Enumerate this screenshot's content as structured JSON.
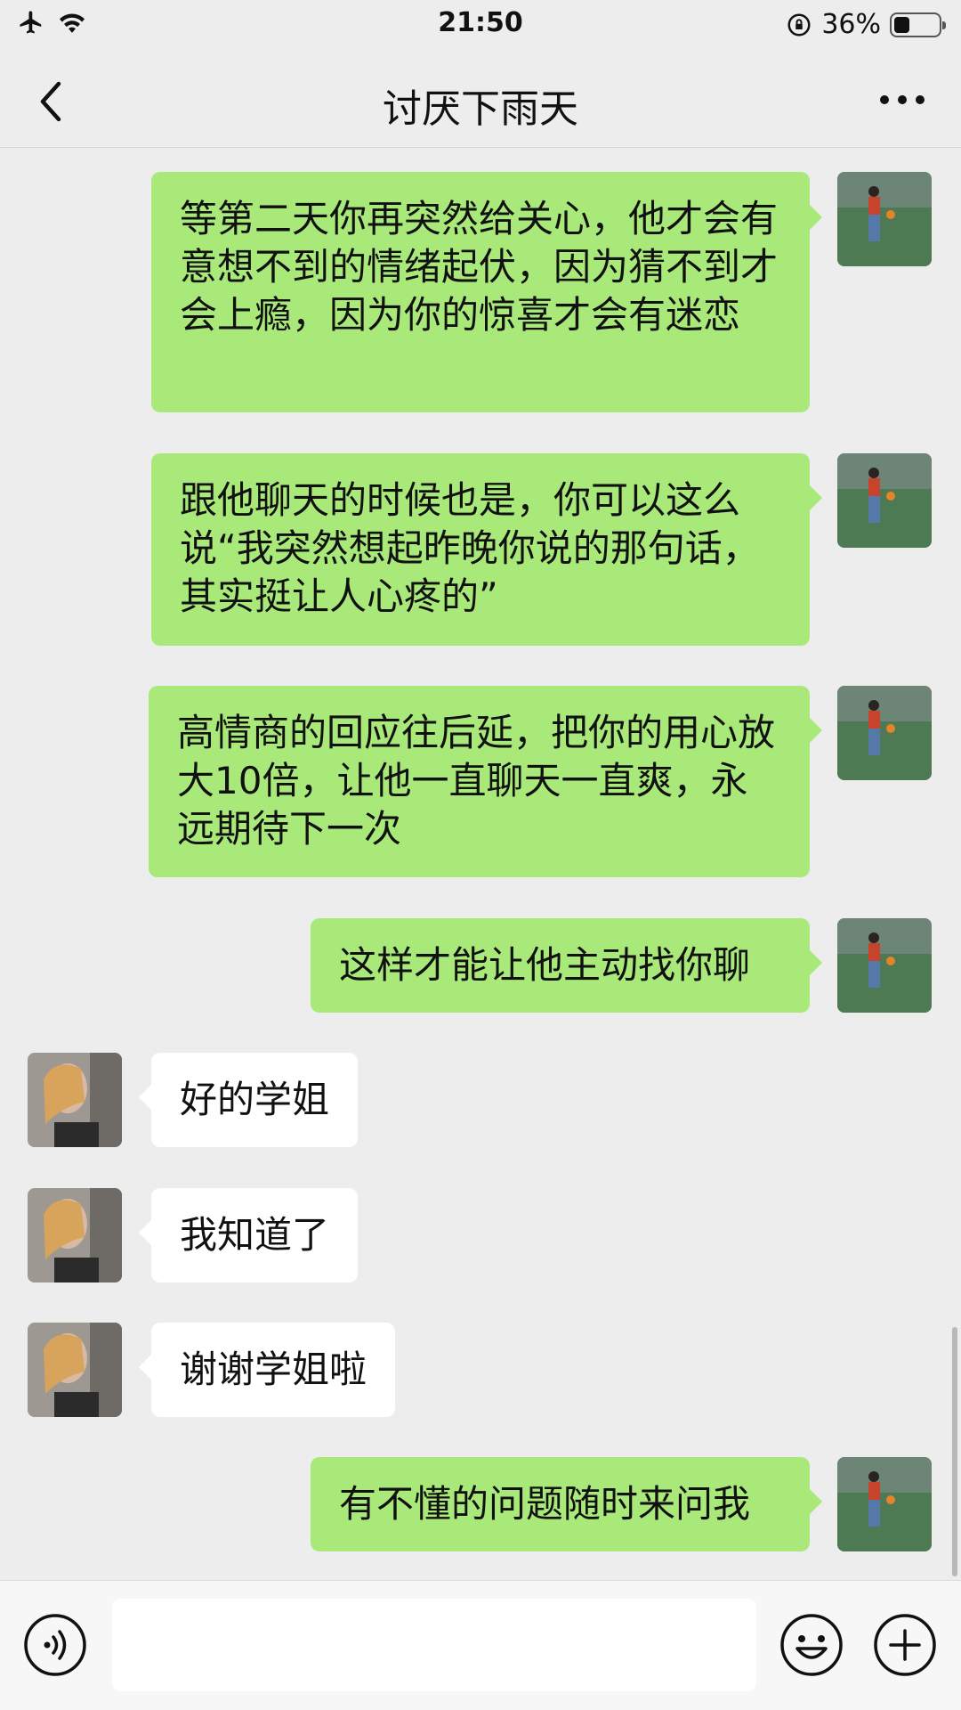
{
  "status_bar": {
    "time": "21:50",
    "battery_percent": "36%",
    "battery_level": 0.36
  },
  "header": {
    "title": "讨厌下雨天",
    "back_icon": "chevron-left-icon",
    "more_icon": "more-dots-icon"
  },
  "messages": [
    {
      "sender": "me",
      "text": "等第二天你再突然给关心，他才会有意想不到的情绪起伏，因为猜不到才会上瘾，因为你的惊喜才会有迷恋"
    },
    {
      "sender": "me",
      "text": "跟他聊天的时候也是，你可以这么说“我突然想起昨晚你说的那句话，其实挺让人心疼的”"
    },
    {
      "sender": "me",
      "text": "高情商的回应往后延，把你的用心放大10倍，让他一直聊天一直爽，永远期待下一次"
    },
    {
      "sender": "me",
      "text": "这样才能让他主动找你聊"
    },
    {
      "sender": "other",
      "text": "好的学姐"
    },
    {
      "sender": "other",
      "text": "我知道了"
    },
    {
      "sender": "other",
      "text": "谢谢学姐啦"
    },
    {
      "sender": "me",
      "text": "有不懂的问题随时来问我"
    }
  ],
  "input_bar": {
    "voice_icon": "voice-icon",
    "emoji_icon": "emoji-icon",
    "add_icon": "plus-icon",
    "input_value": ""
  },
  "colors": {
    "background": "#ededed",
    "my_bubble": "#a9e97a",
    "other_bubble": "#ffffff"
  }
}
